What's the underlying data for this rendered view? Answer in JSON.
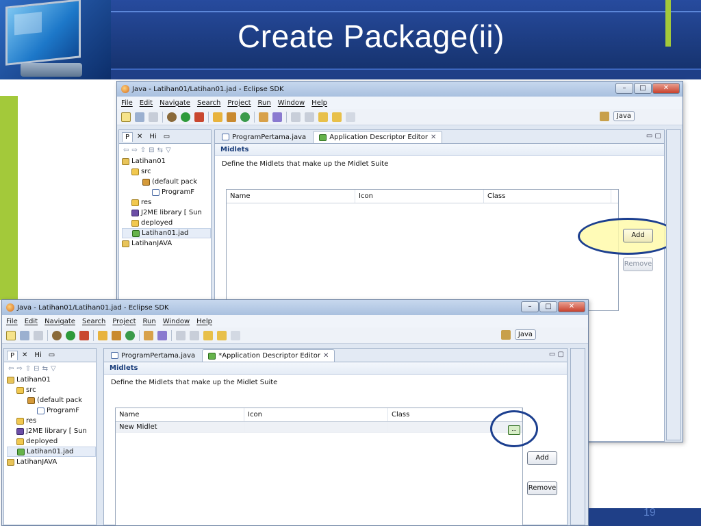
{
  "slide": {
    "title": "Create Package(ii)",
    "page_number": "19"
  },
  "windows": {
    "back": {
      "title": "Java - Latihan01/Latihan01.jad - Eclipse SDK",
      "menu": [
        "File",
        "Edit",
        "Navigate",
        "Search",
        "Project",
        "Run",
        "Window",
        "Help"
      ],
      "perspective": "Java",
      "pane_tabs": [
        "P",
        "Hi"
      ],
      "tree": [
        "Latihan01",
        "src",
        "(default pack",
        "ProgramF",
        "res",
        "J2ME library [ Sun",
        "deployed",
        "Latihan01.jad",
        "LatihanJAVA"
      ],
      "editor_tabs": [
        "ProgramPertama.java",
        "Application Descriptor Editor"
      ],
      "section_title": "Midlets",
      "section_desc": "Define the Midlets that make up the Midlet Suite",
      "columns": [
        "Name",
        "Icon",
        "Class"
      ],
      "add_label": "Add",
      "remove_label": "Remove"
    },
    "front": {
      "title": "Java - Latihan01/Latihan01.jad - Eclipse SDK",
      "menu": [
        "File",
        "Edit",
        "Navigate",
        "Search",
        "Project",
        "Run",
        "Window",
        "Help"
      ],
      "perspective": "Java",
      "pane_tabs": [
        "P",
        "Hi"
      ],
      "tree": [
        "Latihan01",
        "src",
        "(default pack",
        "ProgramF",
        "res",
        "J2ME library [ Sun",
        "deployed",
        "Latihan01.jad",
        "LatihanJAVA"
      ],
      "editor_tabs": [
        "ProgramPertama.java",
        "*Application Descriptor Editor"
      ],
      "section_title": "Midlets",
      "section_desc": "Define the Midlets that make up the Midlet Suite",
      "columns": [
        "Name",
        "Icon",
        "Class"
      ],
      "first_row_name": "New Midlet",
      "ellipsis_label": "...",
      "add_label": "Add",
      "remove_label": "Remove"
    }
  },
  "colors": {
    "slide_blue": "#1f3f87",
    "accent_green": "#a3c93a",
    "callout_border": "#1c3f8f",
    "callout_fill": "#fffaaa"
  }
}
